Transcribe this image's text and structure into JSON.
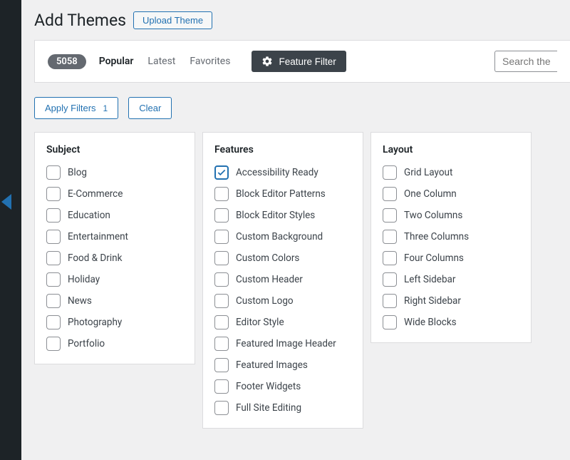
{
  "header": {
    "title": "Add Themes",
    "upload_label": "Upload Theme"
  },
  "filter_bar": {
    "count": "5058",
    "tabs": {
      "popular": "Popular",
      "latest": "Latest",
      "favorites": "Favorites"
    },
    "feature_filter_label": "Feature Filter",
    "search_placeholder": "Search themes..."
  },
  "filter_actions": {
    "apply_label": "Apply Filters",
    "apply_count": "1",
    "clear_label": "Clear"
  },
  "columns": {
    "subject": {
      "heading": "Subject",
      "items": [
        "Blog",
        "E-Commerce",
        "Education",
        "Entertainment",
        "Food & Drink",
        "Holiday",
        "News",
        "Photography",
        "Portfolio"
      ]
    },
    "features": {
      "heading": "Features",
      "items": [
        "Accessibility Ready",
        "Block Editor Patterns",
        "Block Editor Styles",
        "Custom Background",
        "Custom Colors",
        "Custom Header",
        "Custom Logo",
        "Editor Style",
        "Featured Image Header",
        "Featured Images",
        "Footer Widgets",
        "Full Site Editing"
      ],
      "checked_index": 0
    },
    "layout": {
      "heading": "Layout",
      "items": [
        "Grid Layout",
        "One Column",
        "Two Columns",
        "Three Columns",
        "Four Columns",
        "Left Sidebar",
        "Right Sidebar",
        "Wide Blocks"
      ]
    }
  }
}
